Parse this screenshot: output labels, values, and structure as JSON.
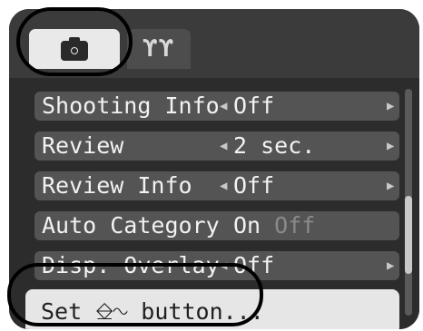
{
  "tabs": [
    {
      "name": "camera",
      "icon": "camera-icon",
      "active": true
    },
    {
      "name": "settings",
      "icon": "settings-tools-icon",
      "glyph": "ϒϒ",
      "active": false
    }
  ],
  "menu": {
    "rows": [
      {
        "label": "Shooting Info",
        "value": "Off"
      },
      {
        "label": "Review",
        "value": "2 sec."
      },
      {
        "label": "Review Info",
        "value": "Off"
      },
      {
        "label": "Auto Category",
        "value_on": "On",
        "value_off": "Off"
      },
      {
        "label": "Disp. Overlay",
        "value": "Off"
      }
    ],
    "set_button": {
      "label": "Set ⎒∿ button..."
    }
  },
  "arrows": {
    "left": "◀",
    "right": "▶"
  }
}
